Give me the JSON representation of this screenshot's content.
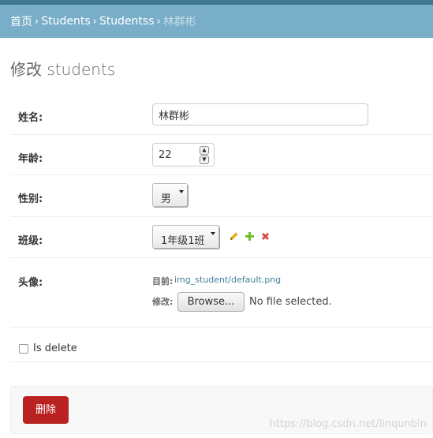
{
  "breadcrumbs": {
    "home": "首页",
    "app": "Students",
    "model": "Studentss",
    "current": "林群彬",
    "separator": "›"
  },
  "page_title": "修改 students",
  "form": {
    "name": {
      "label": "姓名:",
      "value": "林群彬"
    },
    "age": {
      "label": "年龄:",
      "value": "22"
    },
    "gender": {
      "label": "性别:",
      "selected": "男"
    },
    "class": {
      "label": "班级:",
      "selected": "1年级1班"
    },
    "avatar": {
      "label": "头像:",
      "current_label": "目前:",
      "current_file": "img_student/default.png",
      "change_label": "修改:",
      "browse_label": "Browse...",
      "no_file_text": "No file selected."
    },
    "is_delete": {
      "label": "Is delete",
      "checked": false
    }
  },
  "actions": {
    "delete_label": "删除"
  },
  "watermark": "https://blog.csdn.net/linqunbin",
  "colors": {
    "header_dark": "#417690",
    "breadcrumb_bg": "#79aec8",
    "delete_red": "#ba2121",
    "link_blue": "#447e9b"
  },
  "icons": {
    "change_related": "pencil-icon",
    "add_related": "plus-icon",
    "delete_related": "x-icon"
  }
}
